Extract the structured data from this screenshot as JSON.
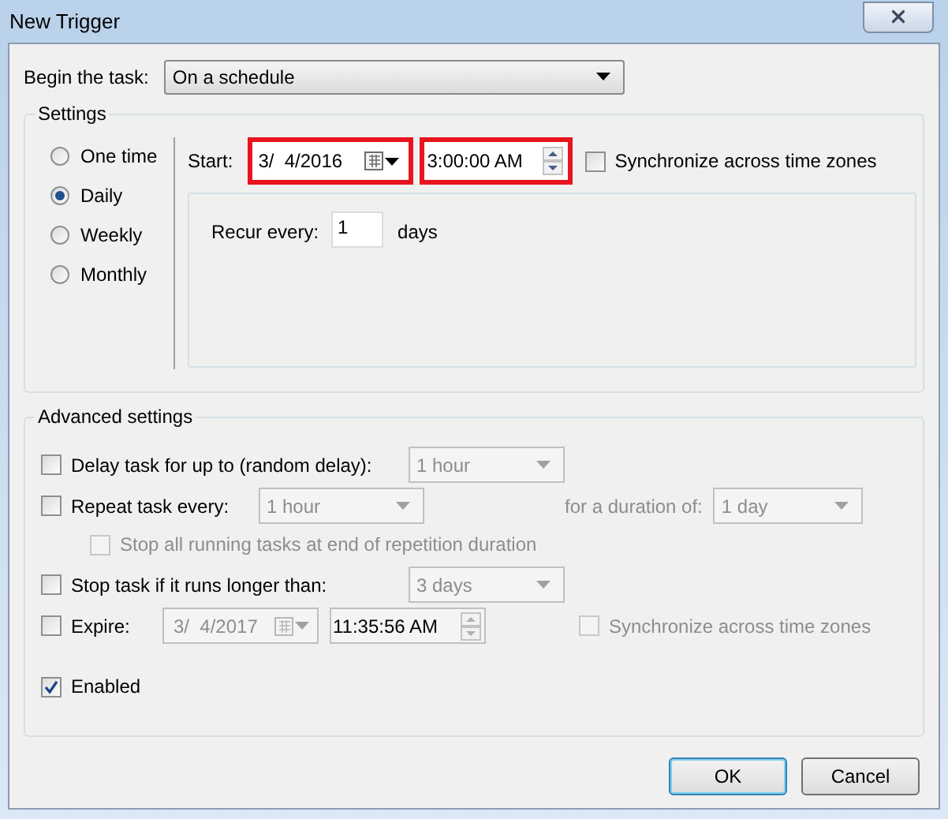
{
  "window": {
    "title": "New Trigger"
  },
  "begin_task": {
    "label": "Begin the task:",
    "value": "On a schedule"
  },
  "settings": {
    "title": "Settings",
    "schedule_options": [
      {
        "label": "One time",
        "selected": false
      },
      {
        "label": "Daily",
        "selected": true
      },
      {
        "label": "Weekly",
        "selected": false
      },
      {
        "label": "Monthly",
        "selected": false
      }
    ],
    "start": {
      "label": "Start:",
      "date": {
        "value": "3/  4/2016",
        "highlighted": true
      },
      "time": {
        "value": "3:00:00 AM",
        "highlighted": true
      },
      "sync": {
        "label": "Synchronize across time zones",
        "checked": false
      }
    },
    "recur": {
      "label": "Recur every:",
      "value": "1",
      "unit": "days"
    }
  },
  "advanced": {
    "title": "Advanced settings",
    "delay": {
      "label": "Delay task for up to (random delay):",
      "checked": false,
      "value": "1 hour"
    },
    "repeat": {
      "label": "Repeat task every:",
      "checked": false,
      "value": "1 hour",
      "duration_label": "for a duration of:",
      "duration_value": "1 day"
    },
    "stop_all": {
      "label": "Stop all running tasks at end of repetition duration",
      "checked": false
    },
    "stop_if": {
      "label": "Stop task if it runs longer than:",
      "checked": false,
      "value": "3 days"
    },
    "expire": {
      "label": "Expire:",
      "checked": false,
      "date": "3/  4/2017",
      "time": "11:35:56 AM",
      "sync_label": "Synchronize across time zones",
      "sync_checked": false
    },
    "enabled": {
      "label": "Enabled",
      "checked": true
    }
  },
  "buttons": [
    {
      "label": "OK",
      "default": true
    },
    {
      "label": "Cancel",
      "default": false
    }
  ]
}
